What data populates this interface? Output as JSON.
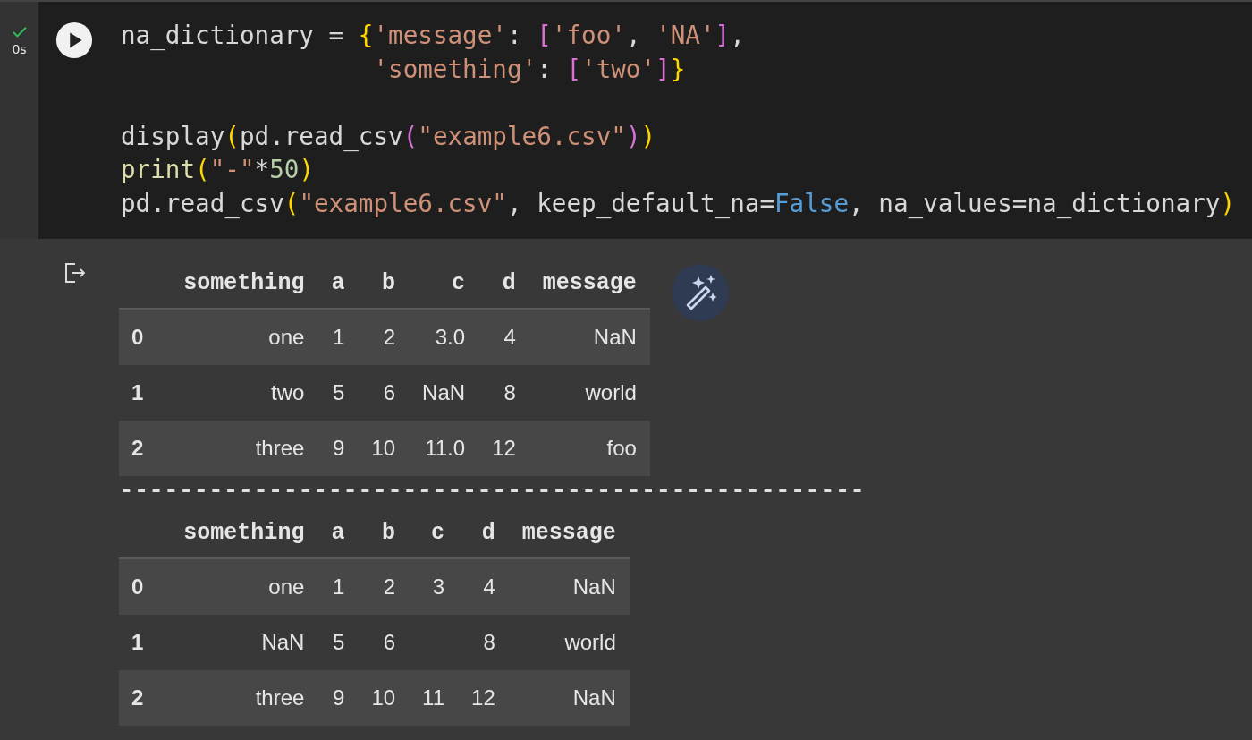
{
  "cell": {
    "succeeded": true,
    "run_time": "0s",
    "code_lines": [
      {
        "continuation": false,
        "blank_line_before": false,
        "tokens": [
          {
            "kind": "plain",
            "text": "na_dictionary = "
          },
          {
            "kind": "bracket1",
            "text": "{"
          },
          {
            "kind": "string",
            "text": "'message'"
          },
          {
            "kind": "plain",
            "text": ": "
          },
          {
            "kind": "bracket2",
            "text": "["
          },
          {
            "kind": "string",
            "text": "'foo'"
          },
          {
            "kind": "plain",
            "text": ", "
          },
          {
            "kind": "string",
            "text": "'NA'"
          },
          {
            "kind": "bracket2",
            "text": "]"
          },
          {
            "kind": "plain",
            "text": ","
          }
        ]
      },
      {
        "continuation": true,
        "blank_line_before": false,
        "tokens": [
          {
            "kind": "string",
            "text": "'something'"
          },
          {
            "kind": "plain",
            "text": ": "
          },
          {
            "kind": "bracket2",
            "text": "["
          },
          {
            "kind": "string",
            "text": "'two'"
          },
          {
            "kind": "bracket2",
            "text": "]"
          },
          {
            "kind": "bracket1",
            "text": "}"
          }
        ]
      },
      {
        "continuation": false,
        "blank_line_before": true,
        "tokens": [
          {
            "kind": "plain",
            "text": "display"
          },
          {
            "kind": "bracket1",
            "text": "("
          },
          {
            "kind": "plain",
            "text": "pd.read_csv"
          },
          {
            "kind": "bracket2",
            "text": "("
          },
          {
            "kind": "string",
            "text": "\"example6.csv\""
          },
          {
            "kind": "bracket2",
            "text": ")"
          },
          {
            "kind": "bracket1",
            "text": ")"
          }
        ]
      },
      {
        "continuation": false,
        "blank_line_before": false,
        "tokens": [
          {
            "kind": "builtin",
            "text": "print"
          },
          {
            "kind": "bracket1",
            "text": "("
          },
          {
            "kind": "string",
            "text": "\"-\""
          },
          {
            "kind": "plain",
            "text": "*"
          },
          {
            "kind": "number",
            "text": "50"
          },
          {
            "kind": "bracket1",
            "text": ")"
          }
        ]
      },
      {
        "continuation": false,
        "blank_line_before": false,
        "tokens": [
          {
            "kind": "plain",
            "text": "pd.read_csv"
          },
          {
            "kind": "bracket1",
            "text": "("
          },
          {
            "kind": "string",
            "text": "\"example6.csv\""
          },
          {
            "kind": "plain",
            "text": ", keep_default_na="
          },
          {
            "kind": "keyword",
            "text": "False"
          },
          {
            "kind": "plain",
            "text": ", na_values=na_dictionary"
          },
          {
            "kind": "bracket1",
            "text": ")"
          }
        ]
      }
    ]
  },
  "output": [
    {
      "kind": "table",
      "columns": [
        "something",
        "a",
        "b",
        "c",
        "d",
        "message"
      ],
      "rows": [
        {
          "index": "0",
          "cells": [
            "one",
            "1",
            "2",
            "3.0",
            "4",
            "NaN"
          ]
        },
        {
          "index": "1",
          "cells": [
            "two",
            "5",
            "6",
            "NaN",
            "8",
            "world"
          ]
        },
        {
          "index": "2",
          "cells": [
            "three",
            "9",
            "10",
            "11.0",
            "12",
            "foo"
          ]
        }
      ]
    },
    {
      "kind": "text",
      "text": "--------------------------------------------------"
    },
    {
      "kind": "table",
      "columns": [
        "something",
        "a",
        "b",
        "c",
        "d",
        "message"
      ],
      "rows": [
        {
          "index": "0",
          "cells": [
            "one",
            "1",
            "2",
            "3",
            "4",
            "NaN"
          ]
        },
        {
          "index": "1",
          "cells": [
            "NaN",
            "5",
            "6",
            null,
            "8",
            "world"
          ]
        },
        {
          "index": "2",
          "cells": [
            "three",
            "9",
            "10",
            "11",
            "12",
            "NaN"
          ]
        }
      ]
    }
  ]
}
